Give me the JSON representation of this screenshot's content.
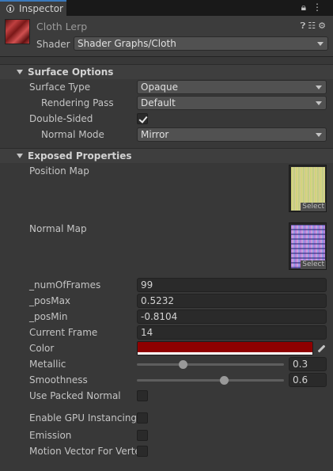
{
  "window": {
    "tab_label": "Inspector",
    "tab_icon": "info-icon"
  },
  "header": {
    "object_name": "Cloth Lerp",
    "shader_label": "Shader",
    "shader_value": "Shader Graphs/Cloth",
    "icons": [
      "help-icon",
      "preset-icon",
      "settings-icon"
    ]
  },
  "surface_options": {
    "title": "Surface Options",
    "surface_type": {
      "label": "Surface Type",
      "value": "Opaque"
    },
    "rendering_pass": {
      "label": "Rendering Pass",
      "value": "Default"
    },
    "double_sided": {
      "label": "Double-Sided",
      "checked": true
    },
    "normal_mode": {
      "label": "Normal Mode",
      "value": "Mirror"
    }
  },
  "exposed_properties": {
    "title": "Exposed Properties",
    "position_map": {
      "label": "Position Map",
      "select_label": "Select"
    },
    "normal_map": {
      "label": "Normal Map",
      "select_label": "Select"
    },
    "num_of_frames": {
      "label": "_numOfFrames",
      "value": "99"
    },
    "pos_max": {
      "label": "_posMax",
      "value": "0.5232"
    },
    "pos_min": {
      "label": "_posMin",
      "value": "-0.8104"
    },
    "current_frame": {
      "label": "Current Frame",
      "value": "14"
    },
    "color": {
      "label": "Color",
      "hex": "#8f0000"
    },
    "metallic": {
      "label": "Metallic",
      "value": "0.3",
      "fraction": 0.3
    },
    "smoothness": {
      "label": "Smoothness",
      "value": "0.6",
      "fraction": 0.6
    },
    "use_packed_normal": {
      "label": "Use Packed Normal",
      "checked": false
    },
    "gpu_instancing": {
      "label": "Enable GPU Instancing",
      "checked": false
    },
    "emission": {
      "label": "Emission",
      "checked": false
    },
    "motion_vector": {
      "label": "Motion Vector For Verte",
      "checked": false
    }
  },
  "colors": {
    "accent": "#3a79bb",
    "panel_bg": "#383838",
    "color_swatch": "#8f0000"
  }
}
